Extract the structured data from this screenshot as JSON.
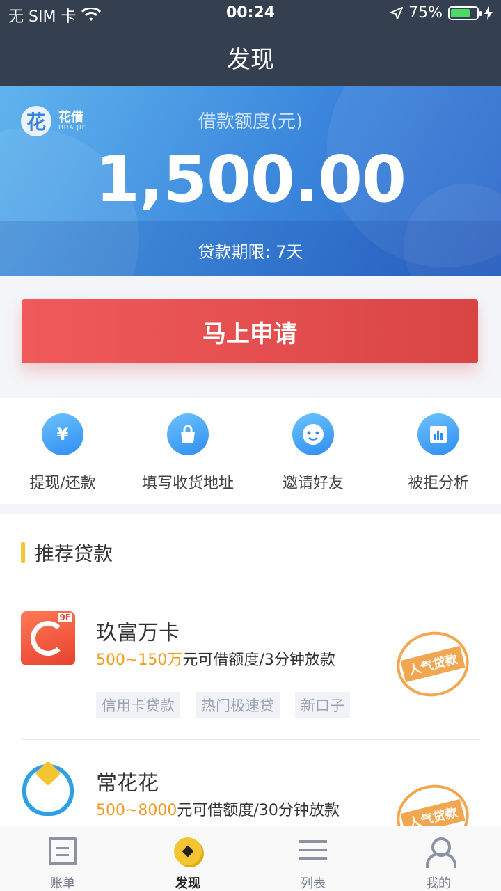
{
  "status_bar": {
    "carrier": "无 SIM 卡",
    "time": "00:24",
    "battery": "75%",
    "battery_level": 0.75
  },
  "nav": {
    "title": "发现"
  },
  "hero": {
    "brand_cn": "花借",
    "brand_en": "HUA JIE",
    "brand_glyph": "花",
    "credit_label": "借款额度(元)",
    "credit_amount": "1,500.00",
    "term": "贷款期限: 7天"
  },
  "apply": {
    "label": "马上申请"
  },
  "quick_actions": [
    {
      "icon": "yen-icon",
      "glyph": "¥",
      "label": "提现/还款"
    },
    {
      "icon": "shopping-bag-icon",
      "glyph": "▥",
      "label": "填写收货地址"
    },
    {
      "icon": "smiley-icon",
      "glyph": "☺",
      "label": "邀请好友"
    },
    {
      "icon": "bar-chart-icon",
      "glyph": "▮",
      "label": "被拒分析"
    }
  ],
  "recommend": {
    "title": "推荐贷款",
    "loans": [
      {
        "name": "玖富万卡",
        "amount": "500~150万",
        "desc_rest": "元可借额度/3分钟放款",
        "tags": [
          "信用卡贷款",
          "热门极速贷",
          "新口子"
        ],
        "badge": "人气贷款",
        "logo_tag": "9F"
      },
      {
        "name": "常花花",
        "amount": "500~8000",
        "desc_rest": "元可借额度/30分钟放款",
        "badge": "人气贷款"
      }
    ]
  },
  "tabbar": [
    {
      "label": "账单",
      "icon": "bill-icon"
    },
    {
      "label": "发现",
      "icon": "discover-icon",
      "active": true
    },
    {
      "label": "列表",
      "icon": "list-icon"
    },
    {
      "label": "我的",
      "icon": "profile-icon"
    }
  ],
  "colors": {
    "nav_bg": "#34404f",
    "primary_blue": "#3b86dc",
    "apply_red": "#e55050",
    "amount_orange": "#f39b21",
    "accent_yellow": "#f5c531"
  }
}
